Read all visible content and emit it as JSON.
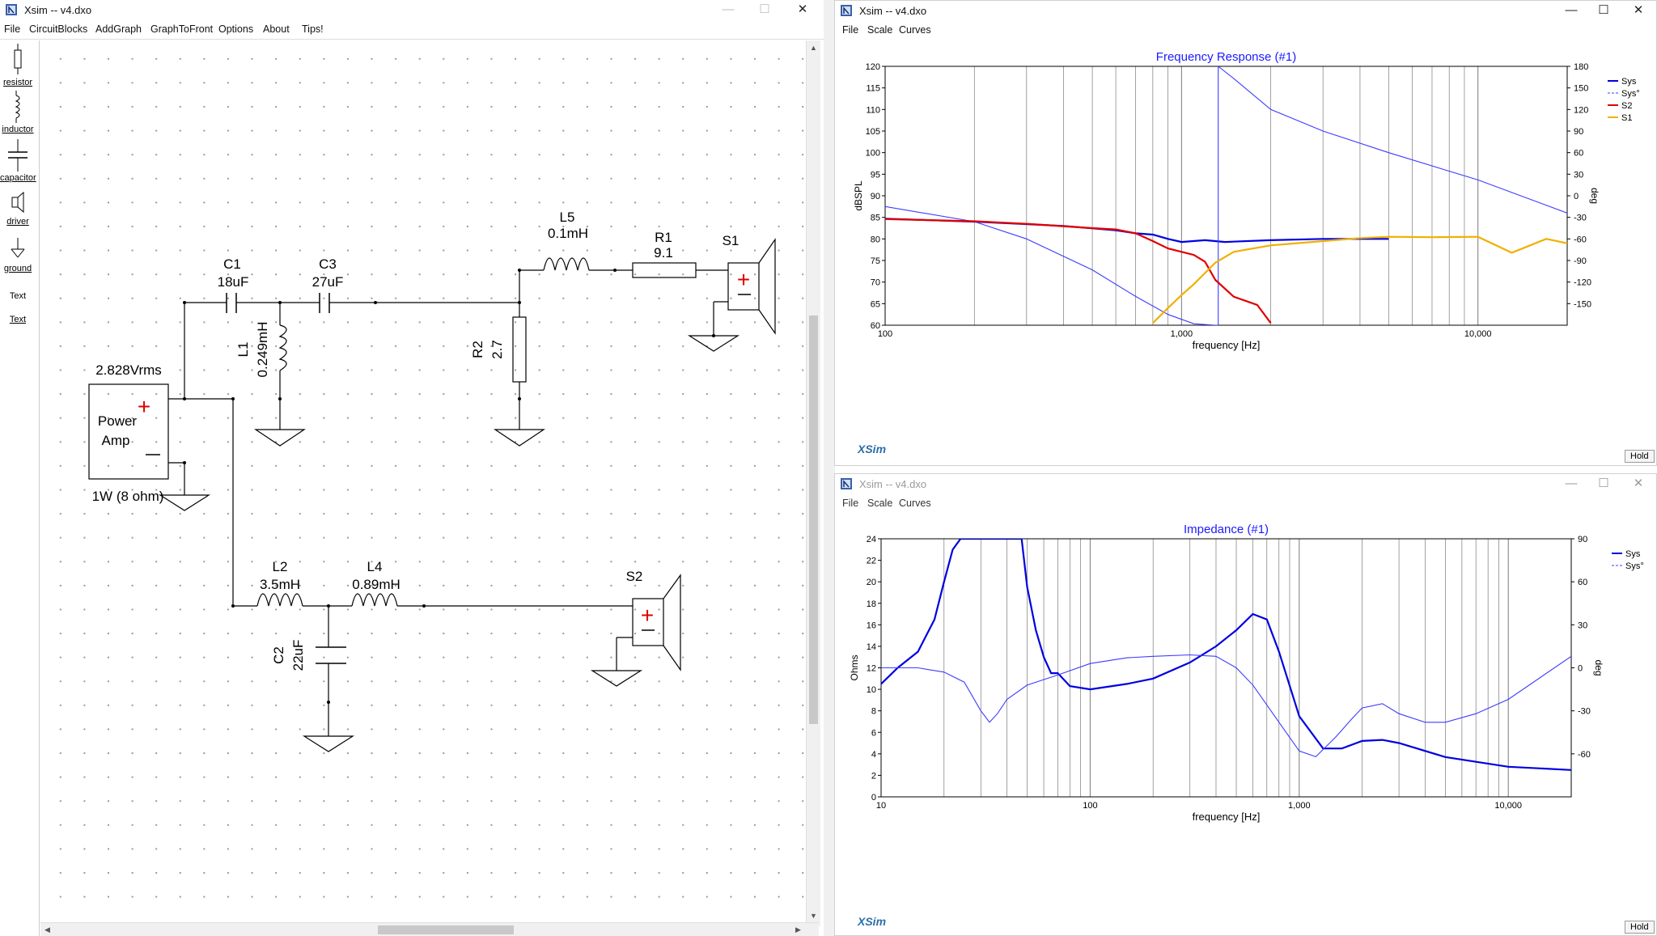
{
  "schematic_window": {
    "title": "Xsim -- v4.dxo",
    "menu": [
      "File",
      "CircuitBlocks",
      "AddGraph",
      "GraphToFront",
      "Options",
      "About",
      "Tips!"
    ],
    "tools": [
      "resistor",
      "inductor",
      "capacitor",
      "driver",
      "ground",
      "Text",
      "Text"
    ],
    "amp": {
      "voltage": "2.828Vrms",
      "line1": "Power",
      "line2": "Amp",
      "power": "1W (8 ohm)"
    },
    "components": {
      "c1_name": "C1",
      "c1_val": "18uF",
      "c3_name": "C3",
      "c3_val": "27uF",
      "l1_name": "L1",
      "l1_val": "0.249mH",
      "l5_name": "L5",
      "l5_val": "0.1mH",
      "r1_name": "R1",
      "r1_val": "9.1",
      "r2_name": "R2",
      "r2_val": "2.7",
      "s1_name": "S1",
      "l2_name": "L2",
      "l2_val": "3.5mH",
      "l4_name": "L4",
      "l4_val": "0.89mH",
      "c2_name": "C2",
      "c2_val": "22uF",
      "s2_name": "S2"
    },
    "window_controls": [
      "—",
      "☐",
      "✕"
    ]
  },
  "fr_window": {
    "title": "Xsim -- v4.dxo",
    "menu": [
      "File",
      "Scale",
      "Curves"
    ],
    "window_controls": [
      "—",
      "☐",
      "✕"
    ],
    "logo": "XSim",
    "hold": "Hold"
  },
  "imp_window": {
    "title": "Xsim -- v4.dxo",
    "menu": [
      "File",
      "Scale",
      "Curves"
    ],
    "window_controls": [
      "—",
      "☐",
      "✕"
    ],
    "logo": "XSim",
    "hold": "Hold"
  },
  "colors": {
    "sys": "#0000e0",
    "sys_phase": "#3c3cff",
    "s2": "#e00000",
    "s1": "#f0b000",
    "title_blue": "#1a1aff",
    "grid": "#7a7a7a"
  },
  "chart_data": [
    {
      "type": "line",
      "title": "Frequency Response (#1)",
      "xlabel": "frequency [Hz]",
      "ylabel": "dBSPL",
      "y2label": "deg",
      "xscale": "log",
      "xlim": [
        100,
        20000
      ],
      "ylim": [
        60,
        120
      ],
      "y2lim": [
        -180,
        180
      ],
      "xticks": [
        "100",
        "1,000",
        "10,000"
      ],
      "yticks": [
        60,
        65,
        70,
        75,
        80,
        85,
        90,
        95,
        100,
        105,
        110,
        115,
        120
      ],
      "y2ticks": [
        -150,
        -120,
        -90,
        -60,
        -30,
        0,
        30,
        60,
        90,
        120,
        150,
        180
      ],
      "legend": "top-right",
      "grid": true,
      "series": [
        {
          "name": "Sys",
          "axis": "left",
          "style": "solid",
          "color": "#0000e0",
          "x": [
            100,
            200,
            400,
            600,
            700,
            800,
            900,
            1000,
            1200,
            1400,
            2000,
            3000,
            5000
          ],
          "y": [
            84.7,
            84.0,
            83.0,
            82.0,
            81.3,
            81.0,
            80.0,
            79.3,
            79.7,
            79.3,
            79.7,
            80.0,
            80.0
          ]
        },
        {
          "name": "Sys°",
          "axis": "right",
          "style": "dashed",
          "color": "#3c3cff",
          "x": [
            100,
            200,
            300,
            500,
            700,
            900,
            1100,
            1300,
            1330,
            1330,
            1500,
            2000,
            3000,
            5000,
            10000,
            20000
          ],
          "y": [
            -15,
            -36,
            -60,
            -103,
            -140,
            -165,
            -178,
            -180,
            -180,
            180,
            163,
            120,
            90,
            60,
            22,
            -24
          ]
        },
        {
          "name": "S2",
          "axis": "left",
          "style": "solid",
          "color": "#e00000",
          "x": [
            100,
            200,
            300,
            500,
            600,
            700,
            800,
            900,
            1000,
            1100,
            1200,
            1300,
            1500,
            1800,
            2000
          ],
          "y": [
            84.6,
            84.1,
            83.5,
            82.5,
            82.2,
            81.3,
            79.5,
            77.8,
            77.0,
            76.3,
            74.7,
            70.5,
            66.6,
            64.7,
            60.5
          ]
        },
        {
          "name": "S1",
          "axis": "left",
          "style": "solid",
          "color": "#f0b000",
          "x": [
            800,
            900,
            1000,
            1100,
            1300,
            1500,
            2000,
            3000,
            4000,
            5000,
            7000,
            10000,
            13000,
            15000,
            17000,
            20000
          ],
          "y": [
            60.5,
            64.0,
            67.0,
            69.5,
            74.5,
            77.0,
            78.5,
            79.5,
            80.2,
            80.5,
            80.4,
            80.5,
            76.8,
            78.5,
            80.0,
            79.0
          ]
        }
      ]
    },
    {
      "type": "line",
      "title": "Impedance (#1)",
      "xlabel": "frequency [Hz]",
      "ylabel": "Ohms",
      "y2label": "deg",
      "xscale": "log",
      "xlim": [
        10,
        20000
      ],
      "ylim": [
        0,
        24
      ],
      "y2lim": [
        -90,
        90
      ],
      "xticks": [
        "10",
        "100",
        "1,000",
        "10,000"
      ],
      "yticks": [
        0,
        2,
        4,
        6,
        8,
        10,
        12,
        14,
        16,
        18,
        20,
        22,
        24
      ],
      "y2ticks": [
        -60,
        -30,
        0,
        30,
        60,
        90
      ],
      "legend": "top-right",
      "grid": true,
      "series": [
        {
          "name": "Sys",
          "axis": "left",
          "style": "solid",
          "color": "#0000e0",
          "x": [
            10,
            12,
            15,
            18,
            20,
            22,
            24,
            47,
            50,
            55,
            60,
            65,
            70,
            80,
            100,
            150,
            200,
            300,
            400,
            500,
            600,
            700,
            800,
            1000,
            1300,
            1600,
            2000,
            2500,
            3000,
            5000,
            10000,
            20000
          ],
          "y": [
            10.5,
            12.0,
            13.5,
            16.5,
            20.0,
            23.0,
            24,
            24,
            19.5,
            15.5,
            13.0,
            11.5,
            11.5,
            10.3,
            10.0,
            10.5,
            11.0,
            12.5,
            14.0,
            15.5,
            17.0,
            16.5,
            13.5,
            7.5,
            4.5,
            4.5,
            5.2,
            5.3,
            5.0,
            3.7,
            2.8,
            2.5
          ]
        },
        {
          "name": "Sys°",
          "axis": "right",
          "style": "dashed",
          "color": "#3c3cff",
          "x": [
            10,
            15,
            20,
            25,
            30,
            33,
            36,
            40,
            50,
            70,
            100,
            150,
            200,
            300,
            400,
            500,
            600,
            800,
            1000,
            1200,
            1500,
            1800,
            2000,
            2500,
            3000,
            4000,
            5000,
            7000,
            10000,
            20000
          ],
          "y": [
            0,
            0,
            -3,
            -10,
            -30,
            -38,
            -32,
            -22,
            -12,
            -5,
            3,
            7,
            8,
            9,
            8,
            0,
            -12,
            -38,
            -58,
            -62,
            -48,
            -35,
            -28,
            -25,
            -32,
            -38,
            -38,
            -32,
            -22,
            8
          ]
        }
      ]
    }
  ]
}
